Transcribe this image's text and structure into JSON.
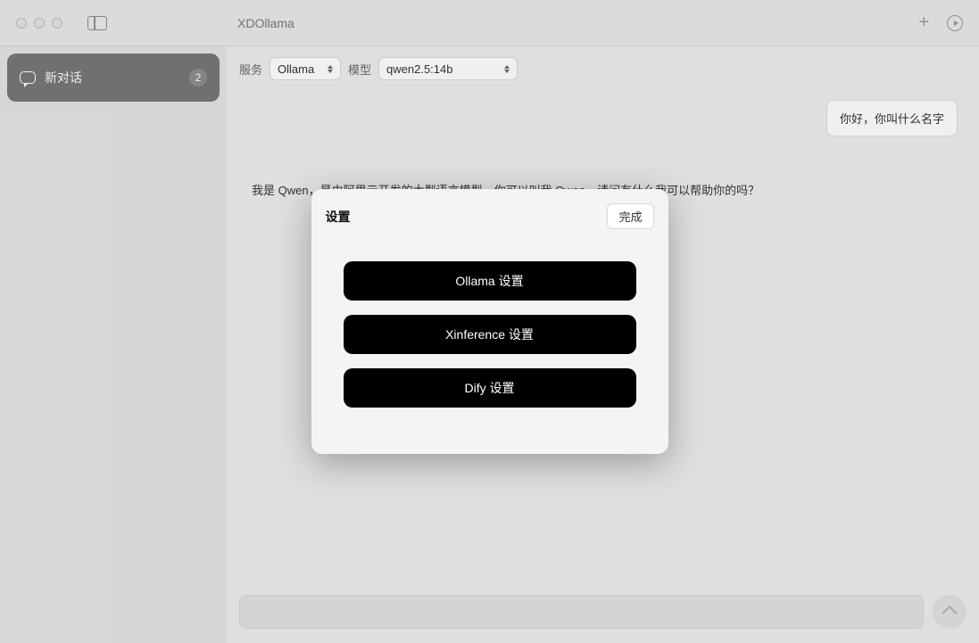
{
  "window": {
    "title": "XDOllama"
  },
  "sidebar": {
    "item": {
      "label": "新对话",
      "badge": "2"
    }
  },
  "controls": {
    "service_label": "服务",
    "service_value": "Ollama",
    "model_label": "模型",
    "model_value": "qwen2.5:14b"
  },
  "messages": {
    "user": "你好，你叫什么名字",
    "assistant": "我是 Qwen，是由阿里云开发的大型语言模型。你可以叫我 Qwen。请问有什么我可以帮助你的吗？"
  },
  "modal": {
    "title": "设置",
    "done": "完成",
    "buttons": [
      "Ollama 设置",
      "Xinference 设置",
      "Dify 设置"
    ]
  }
}
